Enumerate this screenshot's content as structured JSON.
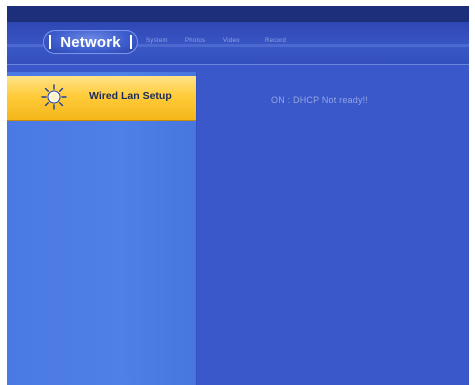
{
  "tabs": {
    "active_label": "Network",
    "system_label": "System",
    "photos_label": "Photos",
    "video_label": "Video",
    "record_label": "Record"
  },
  "menu": {
    "items": [
      {
        "label": "Wired Lan Setup",
        "icon": "sun-icon",
        "selected": true
      }
    ]
  },
  "content": {
    "status": "ON : DHCP Not ready!!"
  },
  "colors": {
    "screen_bg": "#3a58c9",
    "panel_bg": "#4f80e6",
    "highlight": "#ffcc3a"
  }
}
